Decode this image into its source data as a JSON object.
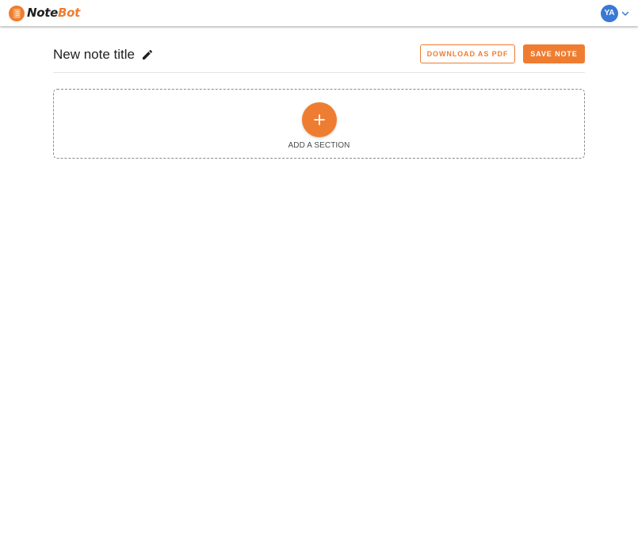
{
  "app": {
    "brand_part_1": "Note",
    "brand_part_2": "Bot",
    "logo_icon": "notebook-icon"
  },
  "user": {
    "initials": "YA",
    "menu_icon": "chevron-down-icon"
  },
  "note": {
    "title": "New note title",
    "edit_icon": "pencil-icon"
  },
  "actions": {
    "download_label": "DOWNLOAD AS PDF",
    "save_label": "SAVE NOTE"
  },
  "add_section": {
    "label": "ADD A SECTION",
    "icon": "plus-icon"
  },
  "colors": {
    "accent": "#ef7d31",
    "avatar": "#3a78d4",
    "text": "#212121"
  }
}
